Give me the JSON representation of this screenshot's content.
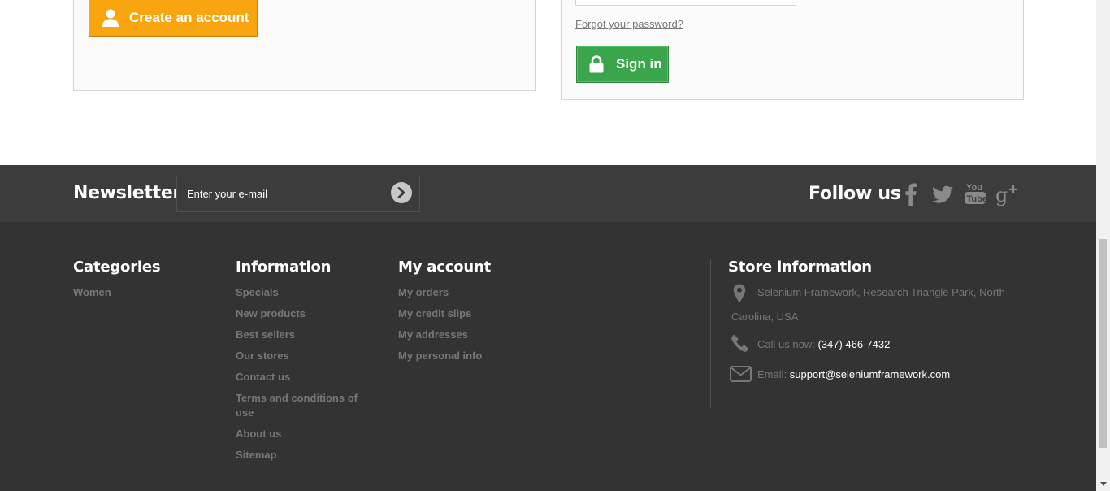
{
  "account": {
    "create_label": "Create an account",
    "forgot_label": "Forgot your password?",
    "signin_label": "Sign in"
  },
  "newsletter": {
    "title": "Newsletter",
    "placeholder": "Enter your e-mail"
  },
  "follow": {
    "title": "Follow us",
    "networks": [
      "facebook-icon",
      "twitter-icon",
      "youtube-icon",
      "google-plus-icon"
    ]
  },
  "footer": {
    "categories": {
      "title": "Categories",
      "items": [
        "Women"
      ]
    },
    "information": {
      "title": "Information",
      "items": [
        "Specials",
        "New products",
        "Best sellers",
        "Our stores",
        "Contact us",
        "Terms and conditions of use",
        "About us",
        "Sitemap"
      ]
    },
    "my_account": {
      "title": "My account",
      "items": [
        "My orders",
        "My credit slips",
        "My addresses",
        "My personal info"
      ]
    },
    "store": {
      "title": "Store information",
      "address": "Selenium Framework, Research Triangle Park, North Carolina, USA",
      "call_label": "Call us now:",
      "phone": "(347) 466-7432",
      "email_label": "Email:",
      "email": "support@seleniumframework.com"
    }
  },
  "colors": {
    "create_button": "#f8a50f",
    "signin_button": "#3aa54b",
    "newsletter_bg": "#3c3c3c",
    "footer_bg": "#333333"
  }
}
